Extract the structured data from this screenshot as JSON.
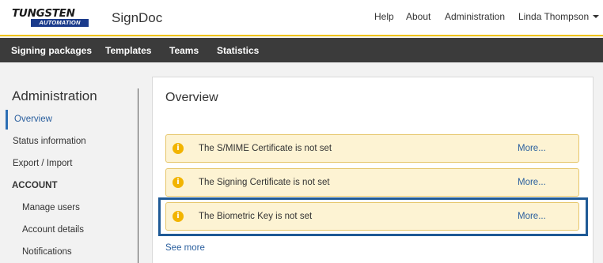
{
  "brand": {
    "logo_top": "TUNGSTEN",
    "logo_bottom": "AUTOMATION",
    "app_title": "SignDoc"
  },
  "topnav": {
    "help": "Help",
    "about": "About",
    "administration": "Administration",
    "user": "Linda Thompson"
  },
  "mainnav": {
    "signing_packages": "Signing packages",
    "templates": "Templates",
    "teams": "Teams",
    "statistics": "Statistics"
  },
  "sidebar": {
    "title": "Administration",
    "overview": "Overview",
    "status_information": "Status information",
    "export_import": "Export / Import",
    "account_header": "ACCOUNT",
    "manage_users": "Manage users",
    "account_details": "Account details",
    "notifications": "Notifications"
  },
  "main": {
    "title": "Overview",
    "alerts": [
      {
        "icon": "i",
        "text": "The S/MIME Certificate is not set",
        "more": "More..."
      },
      {
        "icon": "i",
        "text": "The Signing Certificate is not set",
        "more": "More..."
      },
      {
        "icon": "i",
        "text": "The Biometric Key is not set",
        "more": "More..."
      }
    ],
    "see_more": "See more"
  }
}
